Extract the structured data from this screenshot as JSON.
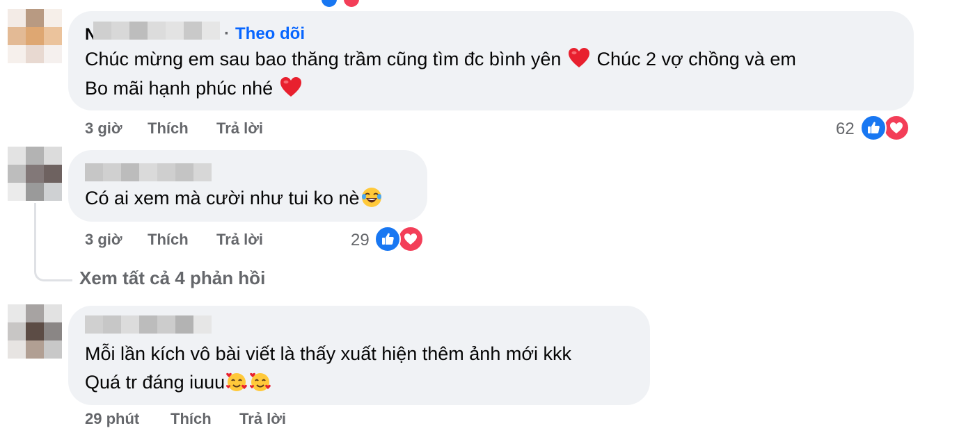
{
  "comments": [
    {
      "author_initial": "N",
      "follow_separator": "·",
      "follow_label": "Theo dõi",
      "text_line1": "Chúc mừng em sau bao thăng trầm cũng tìm đc bình yên",
      "text_line1b": "Chúc 2 vợ chồng và em",
      "text_line2": "Bo mãi hạnh phúc nhé",
      "emoji": [
        "red-heart",
        "red-heart"
      ],
      "time": "3 giờ",
      "like_label": "Thích",
      "reply_label": "Trả lời",
      "reaction_count": "62",
      "reactions": [
        "like-icon",
        "love-icon"
      ]
    },
    {
      "text_line1": "Có ai xem mà cười như tui ko nè",
      "emoji": [
        "face-with-tears-of-joy"
      ],
      "time": "3 giờ",
      "like_label": "Thích",
      "reply_label": "Trả lời",
      "reaction_count": "29",
      "reactions": [
        "like-icon",
        "love-icon"
      ],
      "view_replies": "Xem tất cả 4 phản hồi"
    },
    {
      "text_line1": "Mỗi lần kích vô bài viết là thấy xuất hiện thêm ảnh mới kkk",
      "text_line2": "Quá tr đáng iuuu",
      "emoji": [
        "smiling-face-with-hearts",
        "smiling-face-with-hearts"
      ],
      "time": "29 phút",
      "like_label": "Thích",
      "reply_label": "Trả lời"
    }
  ],
  "colors": {
    "bubble": "#f0f2f5",
    "follow_link": "#0866ff",
    "meta_text": "#65676b",
    "like": "#1877f2",
    "love": "#f33e58"
  }
}
